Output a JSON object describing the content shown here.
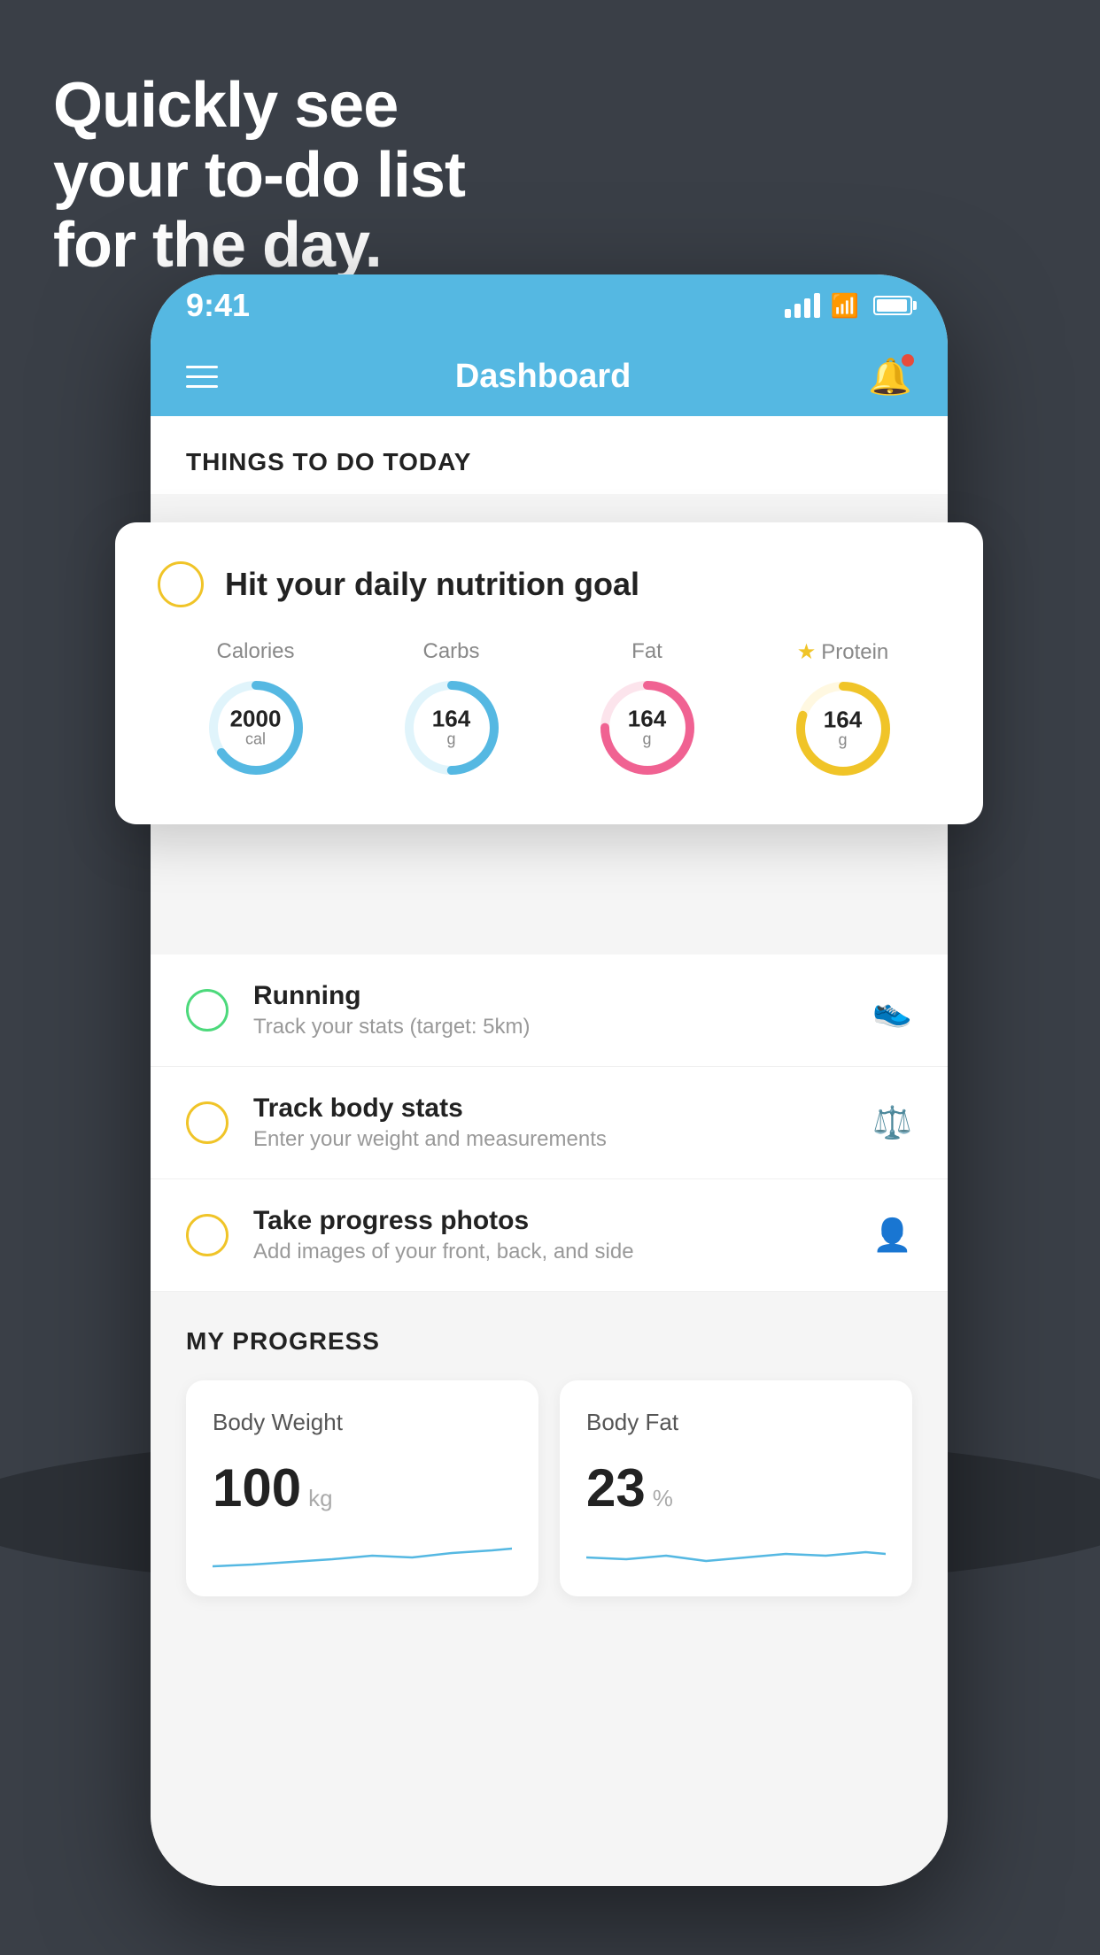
{
  "headline": {
    "line1": "Quickly see",
    "line2": "your to-do list",
    "line3": "for the day."
  },
  "status_bar": {
    "time": "9:41"
  },
  "header": {
    "title": "Dashboard"
  },
  "featured_card": {
    "title": "Hit your daily nutrition goal",
    "items": [
      {
        "label": "Calories",
        "value": "2000",
        "unit": "cal",
        "color": "#55b8e2",
        "track_color": "#e0f4fb",
        "progress": 0.65,
        "starred": false
      },
      {
        "label": "Carbs",
        "value": "164",
        "unit": "g",
        "color": "#55b8e2",
        "track_color": "#e0f4fb",
        "progress": 0.5,
        "starred": false
      },
      {
        "label": "Fat",
        "value": "164",
        "unit": "g",
        "color": "#f06292",
        "track_color": "#fce4ec",
        "progress": 0.75,
        "starred": false
      },
      {
        "label": "Protein",
        "value": "164",
        "unit": "g",
        "color": "#f0c428",
        "track_color": "#fff8e1",
        "progress": 0.8,
        "starred": true
      }
    ]
  },
  "todo_items": [
    {
      "title": "Running",
      "subtitle": "Track your stats (target: 5km)",
      "circle_color": "green",
      "icon": "🏃"
    },
    {
      "title": "Track body stats",
      "subtitle": "Enter your weight and measurements",
      "circle_color": "yellow",
      "icon": "⚖"
    },
    {
      "title": "Take progress photos",
      "subtitle": "Add images of your front, back, and side",
      "circle_color": "yellow",
      "icon": "👤"
    }
  ],
  "progress": {
    "section_title": "MY PROGRESS",
    "cards": [
      {
        "title": "Body Weight",
        "value": "100",
        "unit": "kg"
      },
      {
        "title": "Body Fat",
        "value": "23",
        "unit": "%"
      }
    ]
  },
  "colors": {
    "background": "#3a3f47",
    "header_blue": "#55b8e2",
    "green": "#4cd97b",
    "yellow": "#f0c428",
    "pink": "#f06292",
    "text_dark": "#222222",
    "text_gray": "#999999"
  }
}
